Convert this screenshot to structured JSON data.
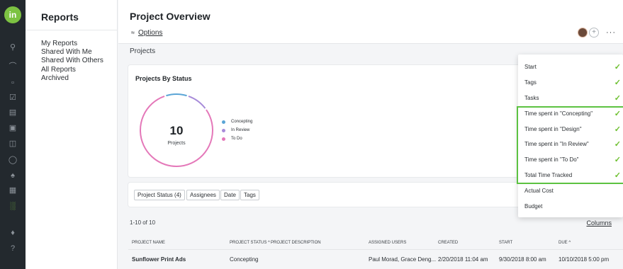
{
  "rail": {
    "logo": "in",
    "icons": [
      "search-icon",
      "dashboard-icon",
      "folder-icon",
      "tasks-icon",
      "inbox-icon",
      "review-icon",
      "calendar-icon",
      "time-icon",
      "people-icon",
      "apps-icon",
      "reports-icon",
      "notifications-icon",
      "help-icon"
    ],
    "active_color": "#7cc242"
  },
  "sidebar": {
    "title": "Reports",
    "items": [
      {
        "label": "My Reports"
      },
      {
        "label": "Shared With Me"
      },
      {
        "label": "Shared With Others"
      },
      {
        "label": "All Reports"
      },
      {
        "label": "Archived"
      }
    ]
  },
  "header": {
    "title": "Project Overview",
    "options_label": "Options",
    "more_label": "···",
    "add_label": "+"
  },
  "projects_label": "Projects",
  "card": {
    "title": "Projects By Status",
    "total": "10",
    "total_label": "Projects"
  },
  "chart_data": {
    "type": "pie",
    "categories": [
      "Concepting",
      "In Review",
      "To Do"
    ],
    "values": [
      1,
      1,
      8
    ],
    "colors": [
      "#5aa5d6",
      "#a78bd9",
      "#e478b9"
    ]
  },
  "filters": [
    {
      "label": "Project Status (4)"
    },
    {
      "label": "Assignees"
    },
    {
      "label": "Date"
    },
    {
      "label": "Tags"
    }
  ],
  "table": {
    "count": "1-10 of 10",
    "columns_link": "Columns",
    "headers": {
      "name": "PROJECT NAME",
      "status": "PROJECT STATUS ^",
      "description": "PROJECT DESCRIPTION",
      "users": "ASSIGNED USERS",
      "created": "CREATED",
      "start": "START",
      "due": "DUE ^"
    },
    "rows": [
      {
        "name": "Sunflower Print Ads",
        "status": "Concepting",
        "description": "",
        "users": "Paul Morad, Grace Deng...",
        "created": "2/20/2018 11:04 am",
        "start": "9/30/2018 8:00 am",
        "due": "10/10/2018 5:00 pm"
      }
    ]
  },
  "menu": {
    "items": [
      {
        "label": "Start",
        "checked": "✓"
      },
      {
        "label": "Tags",
        "checked": "✓"
      },
      {
        "label": "Tasks",
        "checked": "✓"
      },
      {
        "label": "Time spent in \"Concepting\"",
        "checked": "✓"
      },
      {
        "label": "Time spent in \"Design\"",
        "checked": "✓"
      },
      {
        "label": "Time spent in \"In Review\"",
        "checked": "✓"
      },
      {
        "label": "Time spent in \"To Do\"",
        "checked": "✓"
      },
      {
        "label": "Total Time Tracked",
        "checked": "✓"
      },
      {
        "label": "Actual Cost",
        "checked": ""
      },
      {
        "label": "Budget",
        "checked": ""
      }
    ],
    "highlight_color": "#5cc241"
  }
}
